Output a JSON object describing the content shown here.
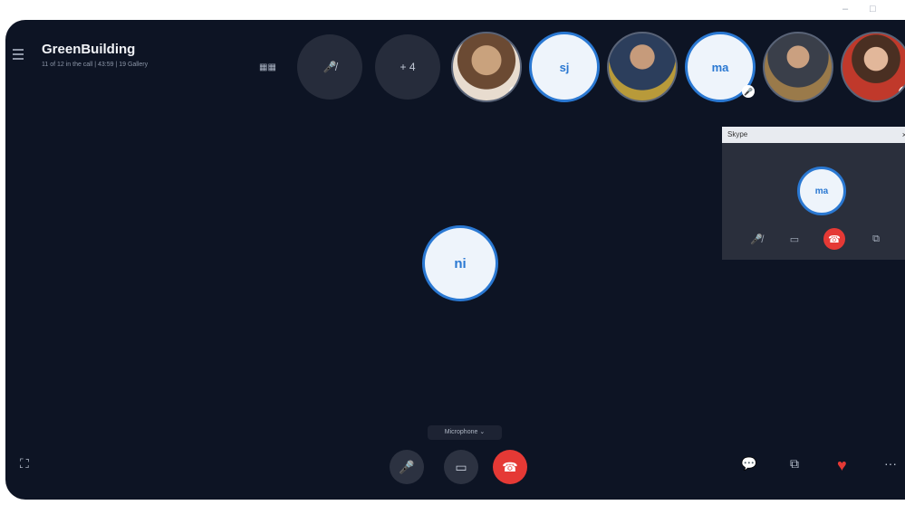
{
  "window": {
    "title": "GreenBuilding",
    "subtitle": "11 of 12 in the call | 43:59 | 19 Gallery"
  },
  "window_controls": {
    "minimize": "–",
    "maximize": "□"
  },
  "top_strip": {
    "grid_icon": "grid-icon",
    "muted_participants": "🎤̸",
    "more_count": "+ 4",
    "participants": [
      {
        "type": "photo",
        "kind": "woman-curly-hair",
        "muted": true
      },
      {
        "type": "initials",
        "initials": "sj",
        "muted": false
      },
      {
        "type": "photo",
        "kind": "man-suit",
        "muted": false
      },
      {
        "type": "initials",
        "initials": "ma",
        "muted": true
      },
      {
        "type": "photo",
        "kind": "man-desk",
        "muted": false
      },
      {
        "type": "photo",
        "kind": "woman-red-top",
        "muted": true
      }
    ]
  },
  "main_participant": {
    "initials": "ni"
  },
  "mini_window": {
    "title": "Skype",
    "close": "×",
    "initials": "ma",
    "controls": [
      "mic-muted-icon",
      "video-off-icon",
      "hangup-icon",
      "popout-icon"
    ]
  },
  "device_label": "Microphone ⌄",
  "bottom_controls": {
    "left": "fullscreen-icon",
    "center": [
      "mic-muted-icon",
      "video-off-icon",
      "hangup-icon"
    ],
    "right": [
      "chat-icon",
      "share-icon",
      "heart-icon",
      "more-icon"
    ],
    "more_label": "···"
  },
  "colors": {
    "accent": "#2a78d2",
    "hangup": "#e53935",
    "background": "#0d1424"
  }
}
